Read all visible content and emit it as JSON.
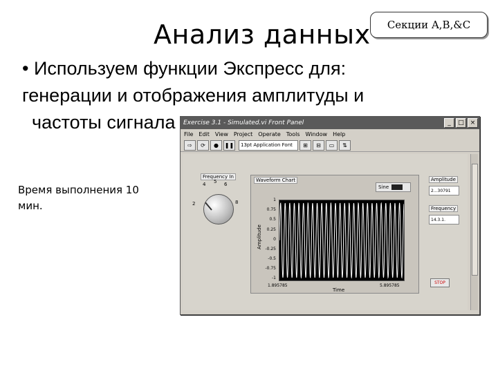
{
  "slide": {
    "title": "Анализ данных",
    "section_label": "Секции A,B,&C",
    "bullet_line1": "• Используем функции Экспресс для:",
    "bullet_line2": "генерации и отображения амплитуды и",
    "bullet_line3": "частоты сигнала",
    "time_note": "Время выполнения 10 мин."
  },
  "window": {
    "title": "Exercise 3.1 - Simulated.vi Front Panel",
    "menu": [
      "File",
      "Edit",
      "View",
      "Project",
      "Operate",
      "Tools",
      "Window",
      "Help"
    ],
    "font_selector": "13pt Application Font",
    "frequency_label": "Frequency In",
    "knob_ticks": [
      "2",
      "4",
      "5",
      "6",
      "8"
    ],
    "chart_label": "Waveform Chart",
    "plot_legend": "Sine",
    "y_axis_label": "Amplitude",
    "y_ticks": [
      "1",
      "0.75",
      "0.5",
      "0.25",
      "0",
      "-0.25",
      "-0.5",
      "-0.75",
      "-1"
    ],
    "x_axis_label": "Time",
    "x_start": "1.895785",
    "x_end": "5.895785",
    "amplitude_label": "Amplitude",
    "amplitude_value": "2...30791",
    "frequency_out_label": "Frequency",
    "frequency_value": "14.3.1.",
    "stop_label": "STOP"
  }
}
